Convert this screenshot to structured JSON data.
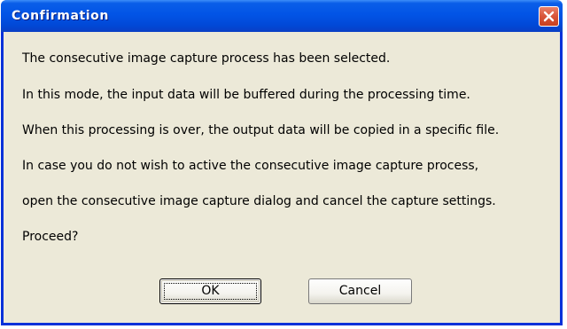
{
  "dialog": {
    "title": "Confirmation",
    "close_icon": "close-icon",
    "accent_color": "#0a5ee8",
    "close_color": "#d8553a"
  },
  "messages": [
    "The consecutive image capture process has been selected.",
    "In this mode, the input data will be buffered during the processing time.",
    "When this processing is over, the output data will be copied in a specific file.",
    "In case you do not wish to active the consecutive image capture process,",
    "open the consecutive image capture dialog and cancel the capture settings.",
    "Proceed?"
  ],
  "buttons": {
    "ok_label": "OK",
    "cancel_label": "Cancel"
  }
}
